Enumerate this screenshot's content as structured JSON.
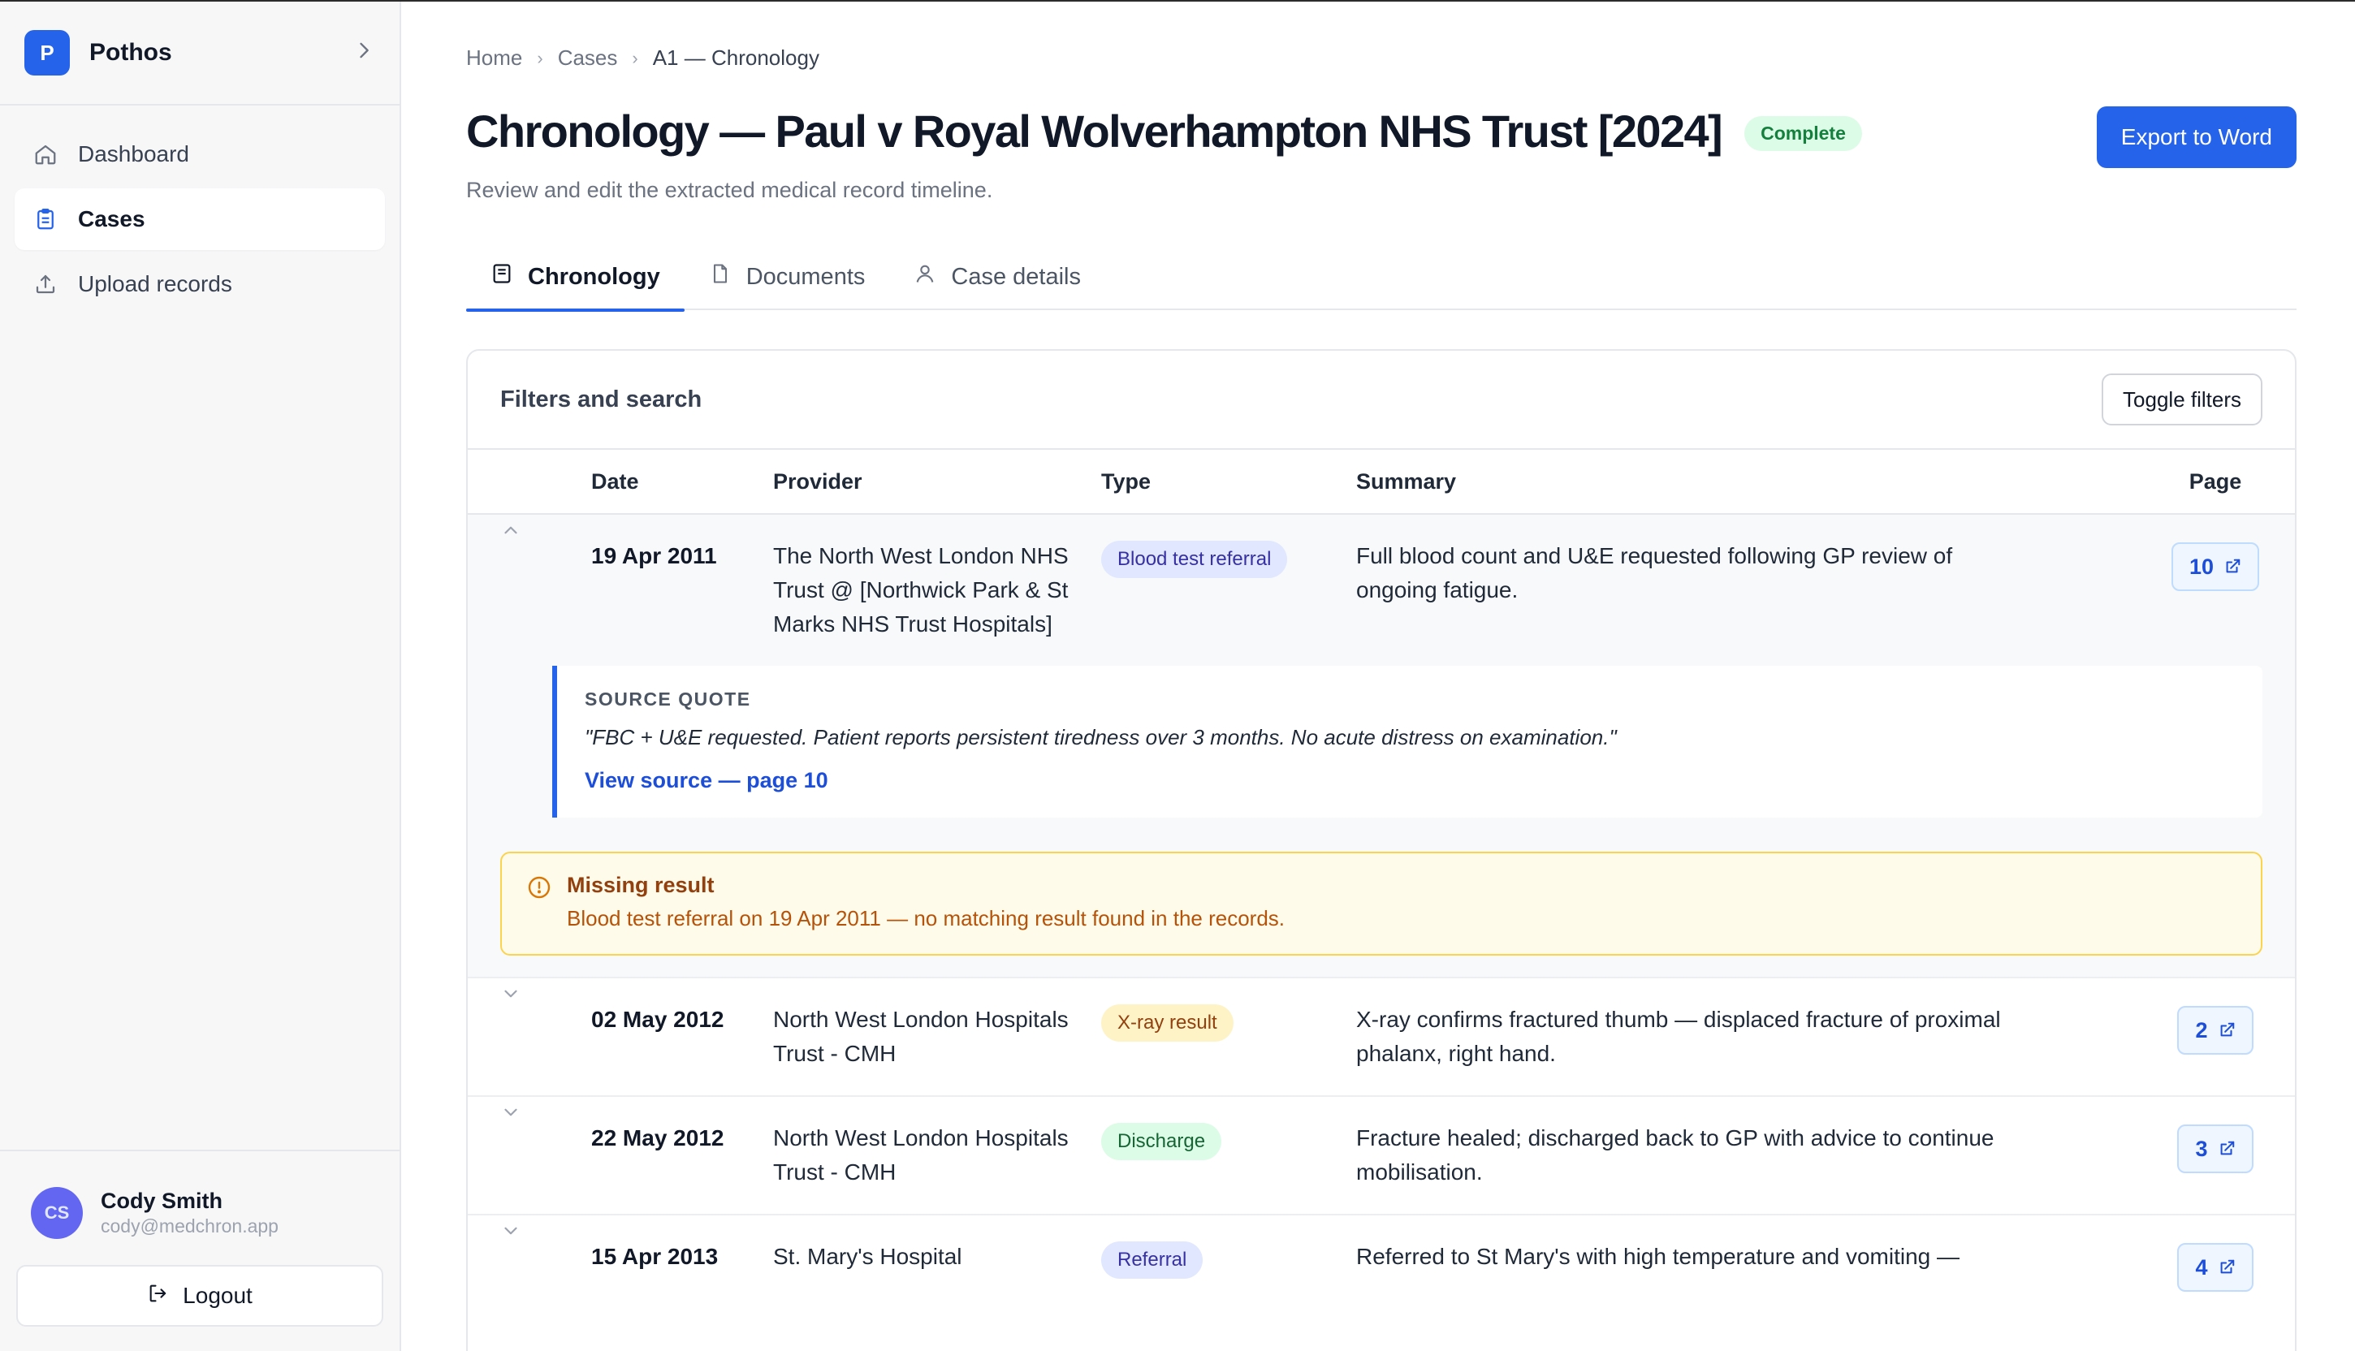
{
  "brand": {
    "initial": "P",
    "name": "Pothos"
  },
  "nav": {
    "items": [
      {
        "label": "Dashboard"
      },
      {
        "label": "Cases"
      },
      {
        "label": "Upload records"
      }
    ]
  },
  "user": {
    "initials": "CS",
    "name": "Cody Smith",
    "email": "cody@medchron.app",
    "logout_label": "Logout"
  },
  "breadcrumb": [
    "Home",
    "Cases",
    "A1 — Chronology"
  ],
  "page": {
    "title": "Chronology — Paul v Royal Wolverhampton NHS Trust [2024]",
    "status": "Complete",
    "subtitle": "Review and edit the extracted medical record timeline.",
    "export_label": "Export to Word"
  },
  "tabs": [
    {
      "label": "Chronology"
    },
    {
      "label": "Documents"
    },
    {
      "label": "Case details"
    }
  ],
  "filters": {
    "title": "Filters and search",
    "toggle_label": "Toggle filters"
  },
  "table": {
    "headers": {
      "date": "Date",
      "provider": "Provider",
      "type": "Type",
      "summary": "Summary",
      "page": "Page"
    },
    "rows": [
      {
        "date": "19 Apr 2011",
        "provider": "The North West London NHS Trust @ [Northwick Park & St Marks NHS Trust Hospitals]",
        "type": "Blood test referral",
        "summary": "Full blood count and U&E requested following GP review of ongoing fatigue.",
        "page": "10"
      },
      {
        "date": "02 May 2012",
        "provider": "North West London Hospitals Trust - CMH",
        "type": "X-ray result",
        "summary": "X-ray confirms fractured thumb — displaced fracture of proximal phalanx, right hand.",
        "page": "2"
      },
      {
        "date": "22 May 2012",
        "provider": "North West London Hospitals Trust - CMH",
        "type": "Discharge",
        "summary": "Fracture healed; discharged back to GP with advice to continue mobilisation.",
        "page": "3"
      },
      {
        "date": "15 Apr 2013",
        "provider": "St. Mary's Hospital",
        "type": "Referral",
        "summary": "Referred to St Mary's with high temperature and vomiting —",
        "page": "4"
      }
    ]
  },
  "source_quote": {
    "label": "SOURCE QUOTE",
    "text": "\"FBC + U&E requested. Patient reports persistent tiredness over 3 months. No acute distress on examination.\"",
    "link": "View source — page 10"
  },
  "warning": {
    "title": "Missing result",
    "text": "Blood test referral on 19 Apr 2011 — no matching result found in the records."
  },
  "colors": {
    "accent": "#2563eb",
    "warning_border": "#fcd34d",
    "success": "#15803d"
  }
}
